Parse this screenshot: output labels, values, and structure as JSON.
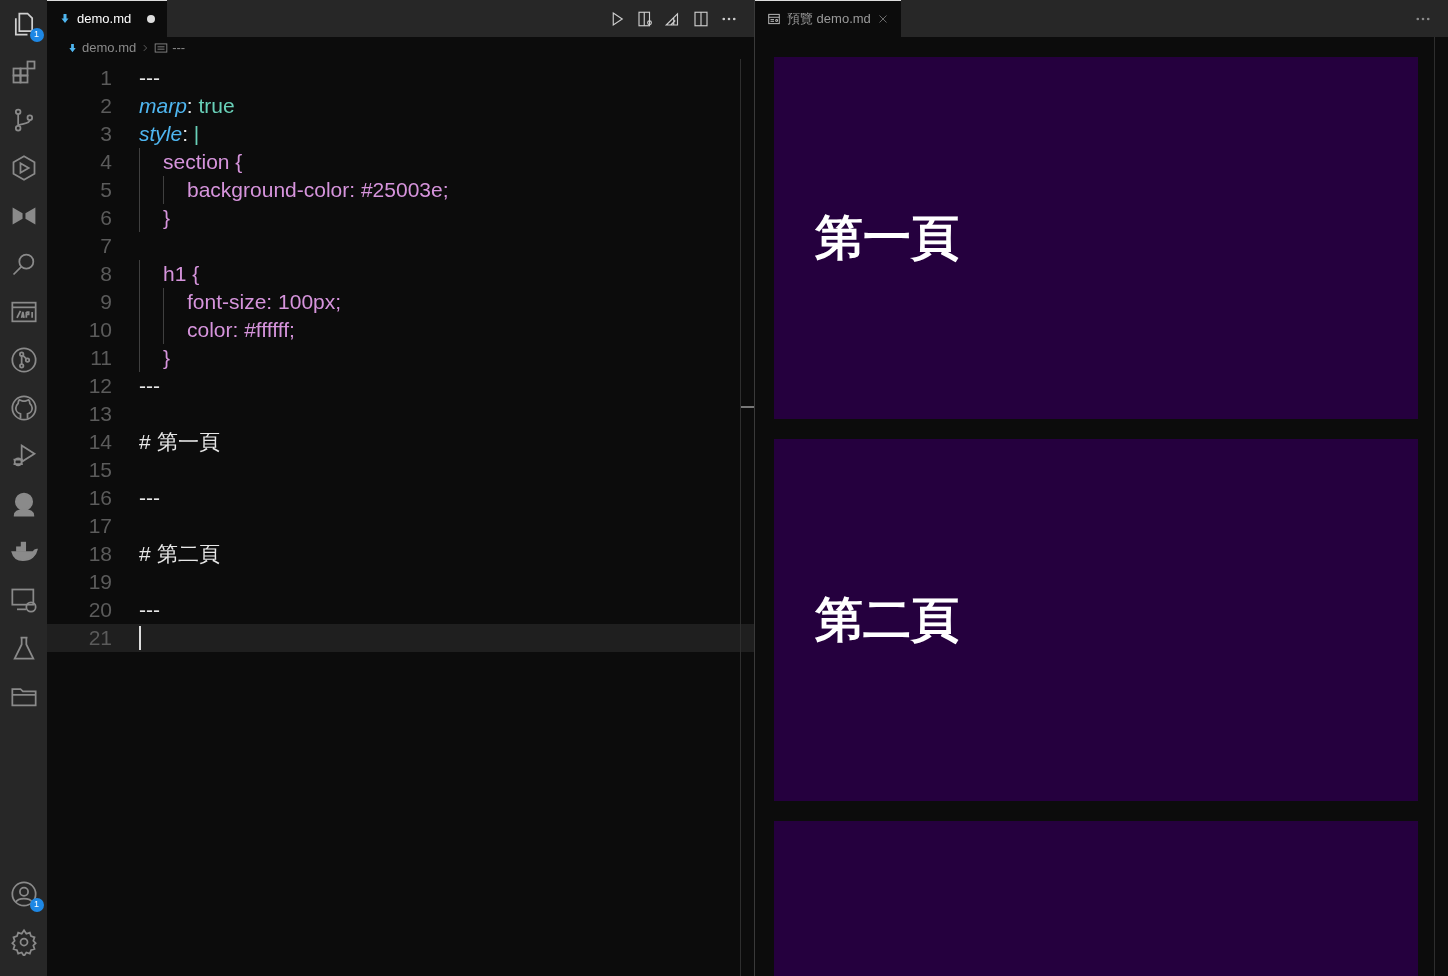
{
  "activity_bar": {
    "explorer_badge": "1",
    "accounts_badge": "1"
  },
  "editor": {
    "tabs": [
      {
        "label": "demo.md",
        "modified": true,
        "selected": true
      }
    ],
    "breadcrumb": [
      "demo.md",
      "---"
    ],
    "lines": [
      {
        "number": "1",
        "tokens": [
          {
            "kind": "plain",
            "text": "---"
          }
        ]
      },
      {
        "number": "2",
        "tokens": [
          {
            "kind": "key",
            "text": "marp"
          },
          {
            "kind": "plain",
            "text": ": "
          },
          {
            "kind": "value",
            "text": "true"
          }
        ]
      },
      {
        "number": "3",
        "tokens": [
          {
            "kind": "key",
            "text": "style"
          },
          {
            "kind": "plain",
            "text": ": "
          },
          {
            "kind": "value",
            "text": "|"
          }
        ]
      },
      {
        "number": "4",
        "tokens": [
          {
            "kind": "css",
            "text": "  section {"
          }
        ]
      },
      {
        "number": "5",
        "tokens": [
          {
            "kind": "css",
            "text": "    background-color: #25003e;"
          }
        ]
      },
      {
        "number": "6",
        "tokens": [
          {
            "kind": "css",
            "text": "  }"
          }
        ]
      },
      {
        "number": "7"
      },
      {
        "number": "8",
        "tokens": [
          {
            "kind": "css",
            "text": "  h1 {"
          }
        ]
      },
      {
        "number": "9",
        "tokens": [
          {
            "kind": "css",
            "text": "    font-size: 100px;"
          }
        ]
      },
      {
        "number": "10",
        "tokens": [
          {
            "kind": "css",
            "text": "    color: #ffffff;"
          }
        ]
      },
      {
        "number": "11",
        "tokens": [
          {
            "kind": "css",
            "text": "  }"
          }
        ]
      },
      {
        "number": "12",
        "tokens": [
          {
            "kind": "plain",
            "text": "---"
          }
        ]
      },
      {
        "number": "13"
      },
      {
        "number": "14",
        "tokens": [
          {
            "kind": "plain",
            "text": "# 第一頁"
          }
        ]
      },
      {
        "number": "15"
      },
      {
        "number": "16",
        "tokens": [
          {
            "kind": "plain",
            "text": "---"
          }
        ]
      },
      {
        "number": "17"
      },
      {
        "number": "18",
        "tokens": [
          {
            "kind": "plain",
            "text": "# 第二頁"
          }
        ]
      },
      {
        "number": "19"
      },
      {
        "number": "20",
        "tokens": [
          {
            "kind": "plain",
            "text": "---"
          }
        ]
      },
      {
        "number": "21",
        "current": true
      }
    ]
  },
  "preview": {
    "tabs": [
      {
        "label": "預覽 demo.md",
        "selected": true
      }
    ],
    "slides": [
      {
        "kind": "title",
        "heading": "第一頁"
      },
      {
        "kind": "title",
        "heading": "第二頁"
      },
      {
        "kind": "blank"
      }
    ]
  }
}
